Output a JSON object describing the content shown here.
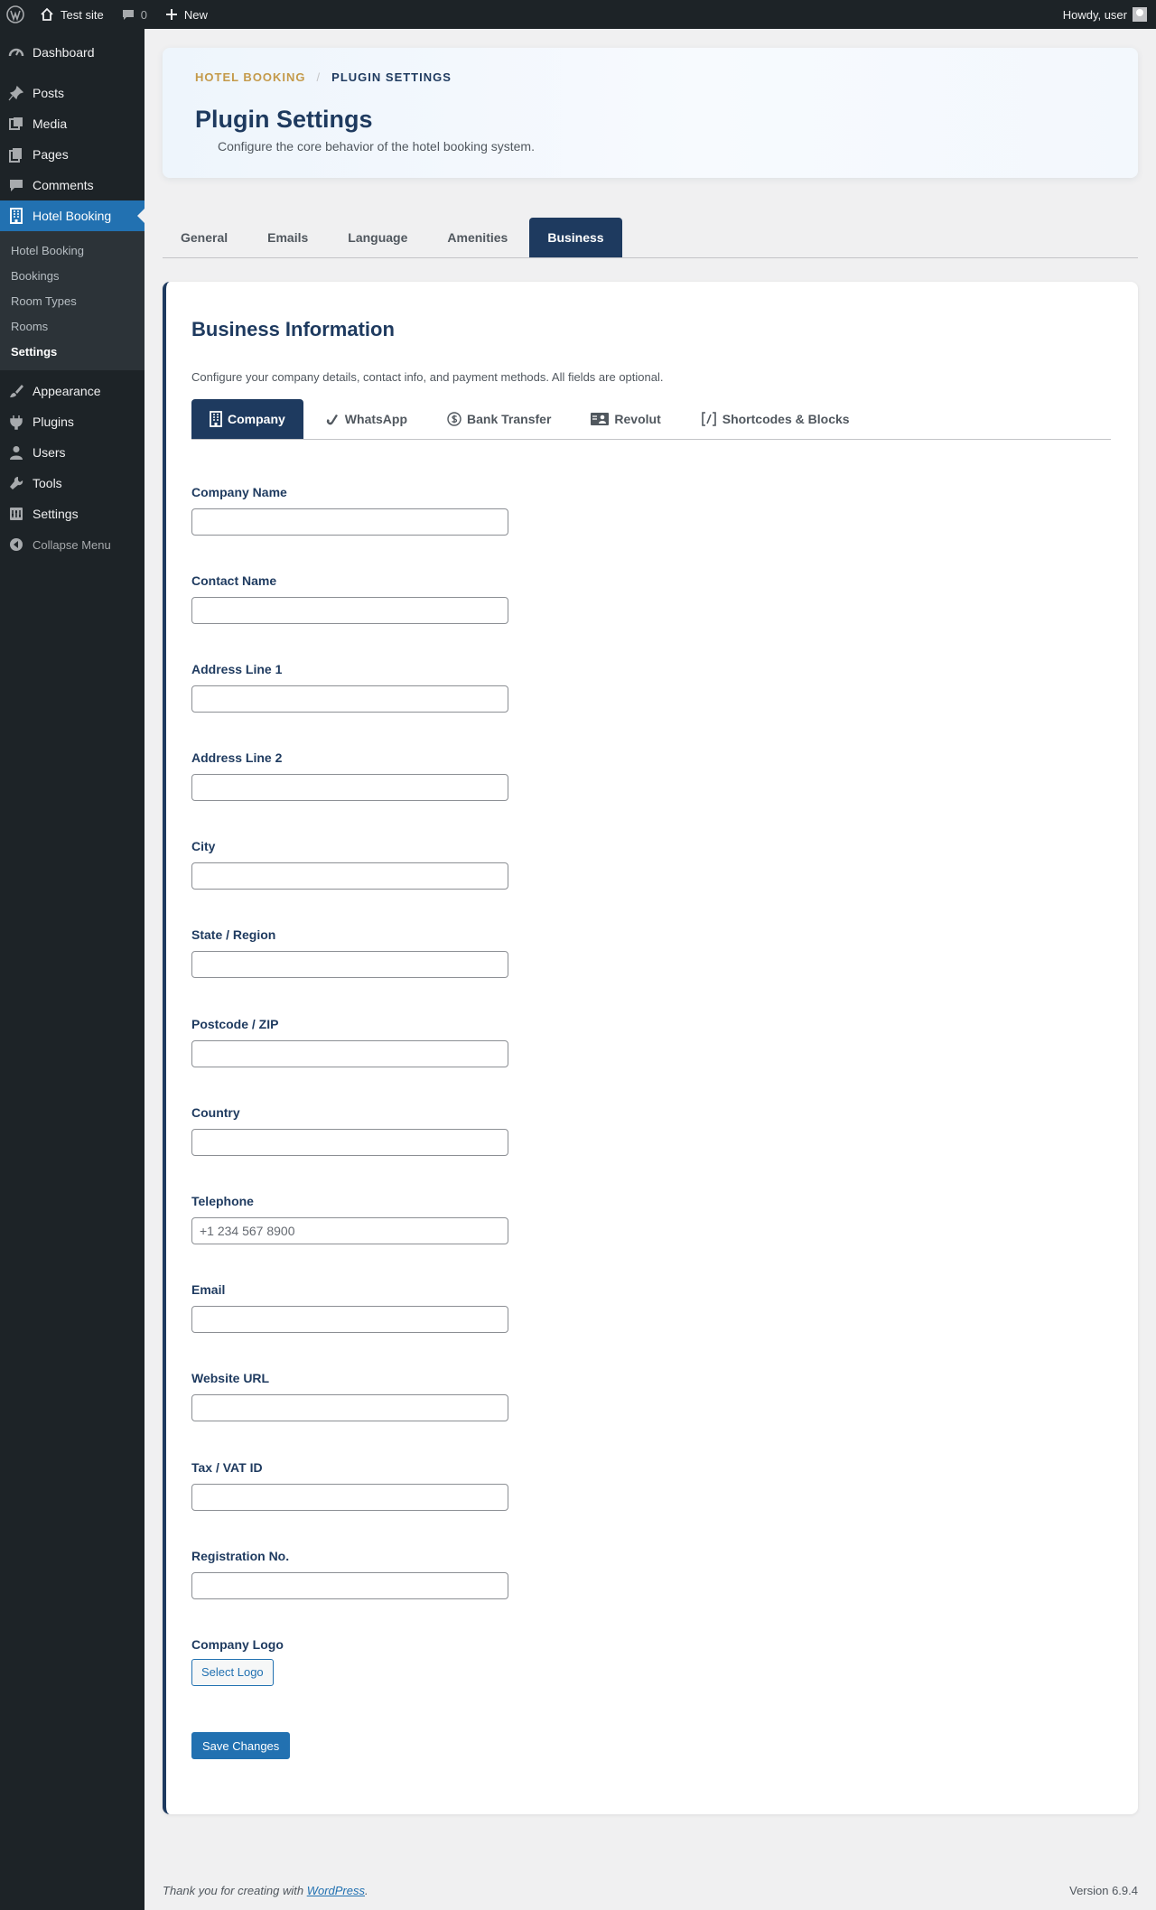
{
  "admin_bar": {
    "site_name": "Test site",
    "comments_count": "0",
    "new_label": "New",
    "howdy": "Howdy, user"
  },
  "sidebar": {
    "items": [
      {
        "label": "Dashboard",
        "icon": "dashboard-icon"
      },
      {
        "label": "Posts",
        "icon": "pin-icon"
      },
      {
        "label": "Media",
        "icon": "media-icon"
      },
      {
        "label": "Pages",
        "icon": "pages-icon"
      },
      {
        "label": "Comments",
        "icon": "comment-icon"
      },
      {
        "label": "Hotel Booking",
        "icon": "building-icon"
      },
      {
        "label": "Appearance",
        "icon": "brush-icon"
      },
      {
        "label": "Plugins",
        "icon": "plug-icon"
      },
      {
        "label": "Users",
        "icon": "user-icon"
      },
      {
        "label": "Tools",
        "icon": "wrench-icon"
      },
      {
        "label": "Settings",
        "icon": "settings-icon"
      }
    ],
    "submenu": [
      "Hotel Booking",
      "Bookings",
      "Room Types",
      "Rooms",
      "Settings"
    ],
    "collapse": "Collapse Menu"
  },
  "header": {
    "breadcrumb_parent": "HOTEL BOOKING",
    "breadcrumb_separator": "/",
    "breadcrumb_current": "PLUGIN SETTINGS",
    "title": "Plugin Settings",
    "subtitle": "Configure the core behavior of the hotel booking system."
  },
  "tabs": [
    "General",
    "Emails",
    "Language",
    "Amenities",
    "Business"
  ],
  "section": {
    "title": "Business Information",
    "description": "Configure your company details, contact info, and payment methods. All fields are optional."
  },
  "subtabs": [
    {
      "label": "Company",
      "icon": "building-icon"
    },
    {
      "label": "WhatsApp",
      "icon": "phone-icon"
    },
    {
      "label": "Bank Transfer",
      "icon": "dollar-icon"
    },
    {
      "label": "Revolut",
      "icon": "id-card-icon"
    },
    {
      "label": "Shortcodes & Blocks",
      "icon": "shortcode-icon"
    }
  ],
  "fields": [
    {
      "label": "Company Name",
      "value": "",
      "placeholder": ""
    },
    {
      "label": "Contact Name",
      "value": "",
      "placeholder": ""
    },
    {
      "label": "Address Line 1",
      "value": "",
      "placeholder": ""
    },
    {
      "label": "Address Line 2",
      "value": "",
      "placeholder": ""
    },
    {
      "label": "City",
      "value": "",
      "placeholder": ""
    },
    {
      "label": "State / Region",
      "value": "",
      "placeholder": ""
    },
    {
      "label": "Postcode / ZIP",
      "value": "",
      "placeholder": ""
    },
    {
      "label": "Country",
      "value": "",
      "placeholder": ""
    },
    {
      "label": "Telephone",
      "value": "",
      "placeholder": "+1 234 567 8900"
    },
    {
      "label": "Email",
      "value": "",
      "placeholder": ""
    },
    {
      "label": "Website URL",
      "value": "",
      "placeholder": ""
    },
    {
      "label": "Tax / VAT ID",
      "value": "",
      "placeholder": ""
    },
    {
      "label": "Registration No.",
      "value": "",
      "placeholder": ""
    }
  ],
  "logo": {
    "label": "Company Logo",
    "button": "Select Logo"
  },
  "save_label": "Save Changes",
  "footer": {
    "thanks_prefix": "Thank you for creating with ",
    "thanks_link": "WordPress",
    "thanks_suffix": ".",
    "version": "Version 6.9.4"
  },
  "colors": {
    "admin_dark": "#1d2327",
    "accent_blue": "#2271b1",
    "navy": "#1e3a5f",
    "gold": "#c49a4a"
  }
}
